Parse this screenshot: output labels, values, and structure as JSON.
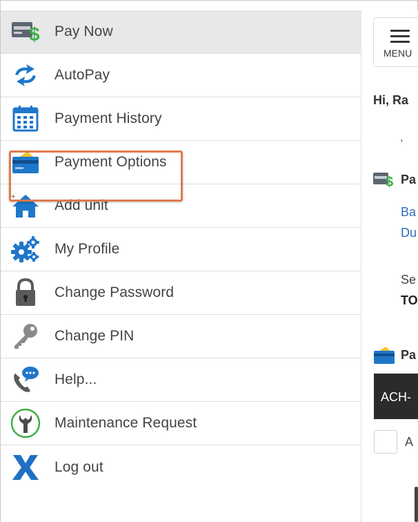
{
  "sidebar": {
    "items": [
      {
        "label": "Pay Now",
        "icon": "pay-now-icon",
        "active": true
      },
      {
        "label": "AutoPay",
        "icon": "autopay-icon"
      },
      {
        "label": "Payment History",
        "icon": "calendar-icon"
      },
      {
        "label": "Payment Options",
        "icon": "credit-card-icon",
        "highlighted": true
      },
      {
        "label": "Add unit",
        "icon": "home-icon"
      },
      {
        "label": "My Profile",
        "icon": "gears-icon"
      },
      {
        "label": "Change Password",
        "icon": "lock-icon"
      },
      {
        "label": "Change PIN",
        "icon": "key-icon"
      },
      {
        "label": "Help...",
        "icon": "phone-chat-icon"
      },
      {
        "label": "Maintenance Request",
        "icon": "wrench-icon"
      },
      {
        "label": "Log out",
        "icon": "x-logout-icon"
      }
    ]
  },
  "header": {
    "menu_label": "MENU"
  },
  "main": {
    "greeting": "Hi, Ra",
    "comma": ",",
    "pay_section_title": "Pa",
    "balance_link": "Ba",
    "due_link": "Du",
    "service_label": "Se",
    "service_value": "TO",
    "payment_section_title": "Pa",
    "ach_label": "ACH-",
    "checkbox_label": "A"
  },
  "colors": {
    "accent_blue": "#2f6db5",
    "highlight_orange": "#e07a4f",
    "active_bg": "#e8e8e8",
    "icon_green": "#3fae49",
    "dark_bar": "#2b2b2b"
  }
}
